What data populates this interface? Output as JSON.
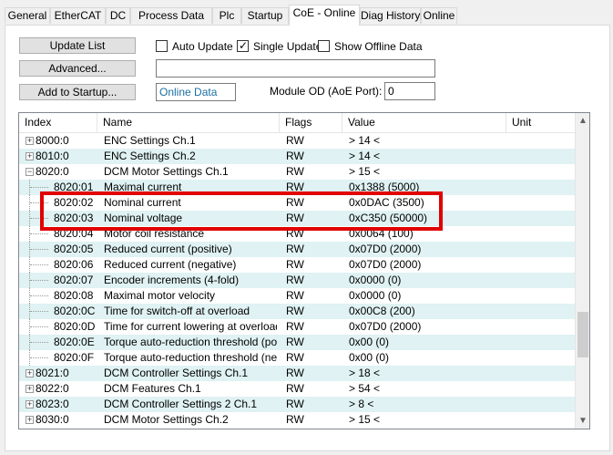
{
  "tabs": [
    {
      "label": "General"
    },
    {
      "label": "EtherCAT"
    },
    {
      "label": "DC"
    },
    {
      "label": "Process Data"
    },
    {
      "label": "Plc"
    },
    {
      "label": "Startup"
    },
    {
      "label": "CoE - Online",
      "active": true
    },
    {
      "label": "Diag History"
    },
    {
      "label": "Online"
    }
  ],
  "toolbar": {
    "update_list": "Update List",
    "advanced": "Advanced...",
    "add_to_startup": "Add to Startup...",
    "auto_update": {
      "label": "Auto Update",
      "checked": false
    },
    "single_update": {
      "label": "Single Update",
      "checked": true
    },
    "show_offline": {
      "label": "Show Offline Data",
      "checked": false
    },
    "filter_value": "",
    "data_source": "Online Data",
    "module_od_label": "Module OD (AoE Port):",
    "module_od_value": "0"
  },
  "table": {
    "columns": [
      "Index",
      "Name",
      "Flags",
      "Value",
      "Unit"
    ],
    "rows": [
      {
        "index": "8000:0",
        "name": "ENC Settings Ch.1",
        "flags": "RW",
        "value": "> 14 <",
        "expander": "+",
        "level": 0
      },
      {
        "index": "8010:0",
        "name": "ENC Settings Ch.2",
        "flags": "RW",
        "value": "> 14 <",
        "expander": "+",
        "level": 0
      },
      {
        "index": "8020:0",
        "name": "DCM Motor Settings Ch.1",
        "flags": "RW",
        "value": "> 15 <",
        "expander": "−",
        "level": 0
      },
      {
        "index": "8020:01",
        "name": "Maximal current",
        "flags": "RW",
        "value": "0x1388 (5000)",
        "level": 1
      },
      {
        "index": "8020:02",
        "name": "Nominal current",
        "flags": "RW",
        "value": "0x0DAC (3500)",
        "level": 1
      },
      {
        "index": "8020:03",
        "name": "Nominal voltage",
        "flags": "RW",
        "value": "0xC350 (50000)",
        "level": 1
      },
      {
        "index": "8020:04",
        "name": "Motor coil resistance",
        "flags": "RW",
        "value": "0x0064 (100)",
        "level": 1
      },
      {
        "index": "8020:05",
        "name": "Reduced current (positive)",
        "flags": "RW",
        "value": "0x07D0 (2000)",
        "level": 1
      },
      {
        "index": "8020:06",
        "name": "Reduced current (negative)",
        "flags": "RW",
        "value": "0x07D0 (2000)",
        "level": 1
      },
      {
        "index": "8020:07",
        "name": "Encoder increments (4-fold)",
        "flags": "RW",
        "value": "0x0000 (0)",
        "level": 1
      },
      {
        "index": "8020:08",
        "name": "Maximal motor velocity",
        "flags": "RW",
        "value": "0x0000 (0)",
        "level": 1
      },
      {
        "index": "8020:0C",
        "name": "Time for switch-off at overload",
        "flags": "RW",
        "value": "0x00C8 (200)",
        "level": 1
      },
      {
        "index": "8020:0D",
        "name": "Time for current lowering at overload",
        "flags": "RW",
        "value": "0x07D0 (2000)",
        "level": 1
      },
      {
        "index": "8020:0E",
        "name": "Torque auto-reduction threshold (posit...",
        "flags": "RW",
        "value": "0x00 (0)",
        "level": 1
      },
      {
        "index": "8020:0F",
        "name": "Torque auto-reduction threshold (neg...",
        "flags": "RW",
        "value": "0x00 (0)",
        "level": 1
      },
      {
        "index": "8021:0",
        "name": "DCM Controller Settings Ch.1",
        "flags": "RW",
        "value": "> 18 <",
        "expander": "+",
        "level": 0
      },
      {
        "index": "8022:0",
        "name": "DCM Features Ch.1",
        "flags": "RW",
        "value": "> 54 <",
        "expander": "+",
        "level": 0
      },
      {
        "index": "8023:0",
        "name": "DCM Controller Settings 2 Ch.1",
        "flags": "RW",
        "value": "> 8 <",
        "expander": "+",
        "level": 0
      },
      {
        "index": "8030:0",
        "name": "DCM Motor Settings Ch.2",
        "flags": "RW",
        "value": "> 15 <",
        "expander": "+",
        "level": 0
      }
    ]
  },
  "colors": {
    "row_alt": "#e0f2f3",
    "highlight": "#e00000",
    "input_text": "#1a6fa3"
  },
  "icons": {
    "scroll_up": "chevron-up-icon",
    "scroll_down": "chevron-down-icon"
  }
}
